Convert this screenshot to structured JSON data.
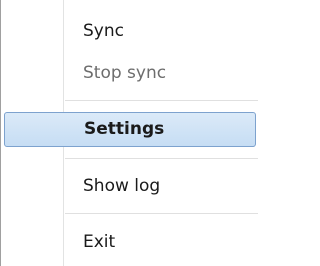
{
  "menu": {
    "items": [
      {
        "label": "Sync",
        "state": "enabled"
      },
      {
        "label": "Stop sync",
        "state": "disabled"
      },
      {
        "label": "Settings",
        "state": "highlighted-default"
      },
      {
        "label": "Show log",
        "state": "enabled"
      },
      {
        "label": "Exit",
        "state": "enabled"
      }
    ]
  },
  "colors": {
    "highlight_fill": "#c6ddf4",
    "highlight_border": "#7da2ce",
    "disabled_text": "#6d6d6d"
  }
}
